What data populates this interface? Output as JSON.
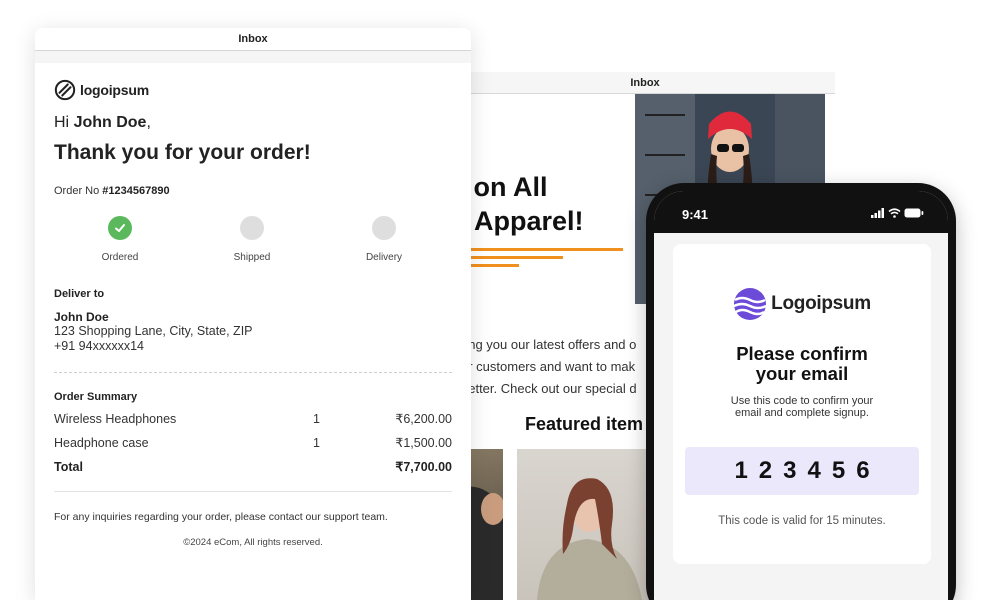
{
  "back_window": {
    "title": "Inbox",
    "headline_line1": "f on All",
    "headline_line2": "r Apparel!",
    "body_line1": "ring you our latest offers and o",
    "body_line2": "ur customers and want to mak",
    "body_line3": "better. Check out our special d",
    "featured": "Featured item"
  },
  "front_window": {
    "title": "Inbox",
    "brand": "logoipsum",
    "greeting_prefix": "Hi ",
    "customer_name": "John Doe",
    "greeting_suffix": ",",
    "thanks": "Thank you for your order!",
    "order_label": "Order No ",
    "order_number": "#1234567890",
    "steps": [
      {
        "label": "Ordered",
        "status": "done"
      },
      {
        "label": "Shipped",
        "status": "pending"
      },
      {
        "label": "Delivery",
        "status": "pending"
      }
    ],
    "deliver_title": "Deliver to",
    "deliver_name": "John Doe",
    "deliver_address": "123 Shopping Lane, City, State, ZIP",
    "deliver_phone": "+91 94xxxxxx14",
    "summary_title": "Order Summary",
    "items": [
      {
        "name": "Wireless Headphones",
        "qty": "1",
        "price": "₹6,200.00"
      },
      {
        "name": "Headphone case",
        "qty": "1",
        "price": "₹1,500.00"
      }
    ],
    "total_label": "Total",
    "total_value": "₹7,700.00",
    "footer": "For any inquiries regarding your order, please contact our support team.",
    "copyright": "©2024 eCom, All rights reserved."
  },
  "phone": {
    "time": "9:41",
    "brand": "Logoipsum",
    "title_line1": "Please confirm",
    "title_line2": "your email",
    "sub_line1": "Use this code to confirm your",
    "sub_line2": "email and complete signup.",
    "code": "123456",
    "validity": "This code is valid for 15 minutes."
  },
  "colors": {
    "accent_orange": "#f0901e",
    "success_green": "#5cb85c",
    "code_bg": "#ebe8fb",
    "brand_purple": "#6c4bd8"
  },
  "icons": {
    "front_logo": "logoipsum-icon",
    "phone_logo": "logoipsum-wave-icon",
    "step_done": "check-icon"
  }
}
